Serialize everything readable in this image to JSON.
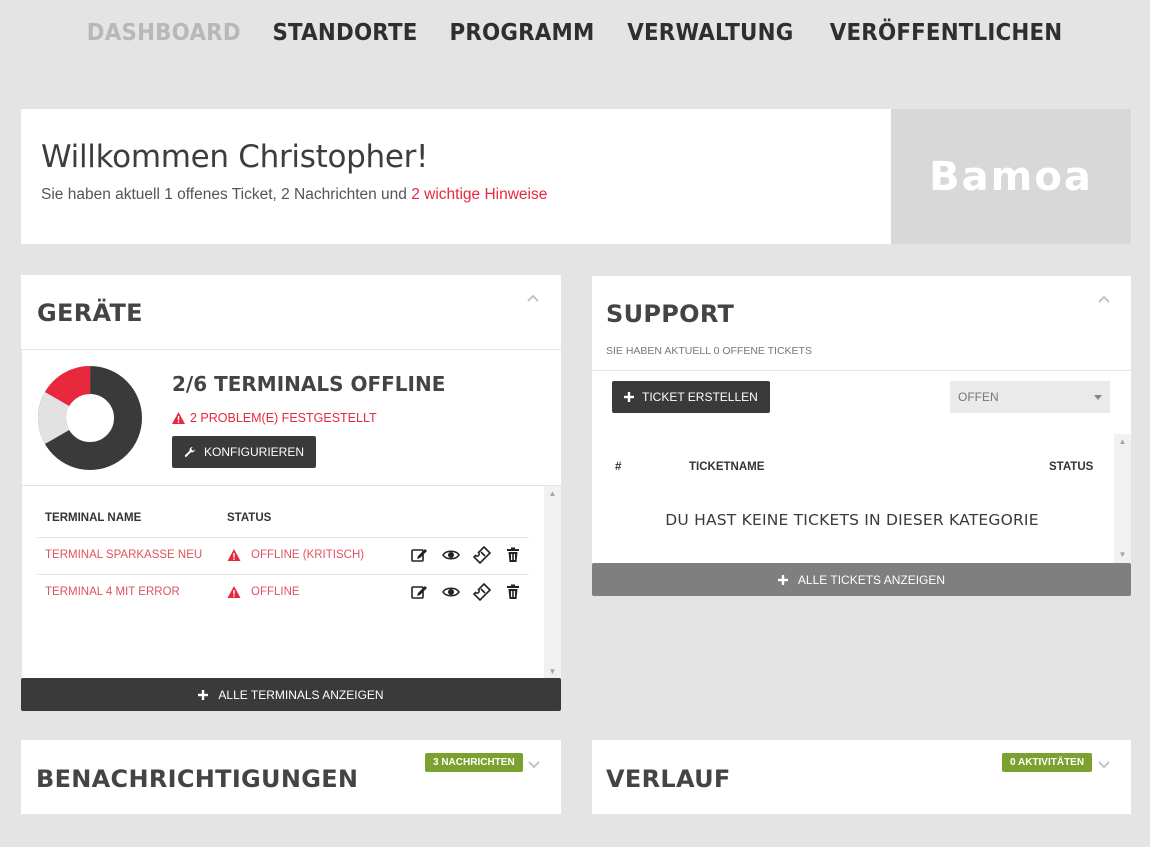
{
  "nav": {
    "items": [
      "DASHBOARD",
      "STANDORTE",
      "PROGRAMM",
      "VERWALTUNG",
      "VERÖFFENTLICHEN"
    ]
  },
  "welcome": {
    "title": "Willkommen Christopher!",
    "text_before": "Sie haben aktuell 1 offenes Ticket, 2 Nachrichten und ",
    "highlight": "2 wichtige Hinweise",
    "logo": "Bamoa"
  },
  "devices": {
    "title": "GERÄTE",
    "headline": "2/6 TERMINALS OFFLINE",
    "problem": "2 PROBLEM(E) FESTGESTELLT",
    "configure_label": "KONFIGURIEREN",
    "donut": {
      "offline_fraction": 0.1667,
      "problem_fraction": 0.1667,
      "online_fraction": 0.6667
    },
    "columns": [
      "TERMINAL NAME",
      "STATUS"
    ],
    "rows": [
      {
        "name": "TERMINAL SPARKASSE NEU",
        "status": "OFFLINE (KRITISCH)"
      },
      {
        "name": "TERMINAL 4 MIT ERROR",
        "status": "OFFLINE"
      }
    ],
    "show_all_label": "ALLE TERMINALS ANZEIGEN"
  },
  "support": {
    "title": "SUPPORT",
    "subtitle": "SIE HABEN AKTUELL 0 OFFENE TICKETS",
    "create_label": "TICKET ERSTELLEN",
    "filter_value": "OFFEN",
    "columns": [
      "#",
      "TICKETNAME",
      "STATUS"
    ],
    "empty_text": "DU HAST KEINE TICKETS IN DIESER KATEGORIE",
    "show_all_label": "ALLE TICKETS ANZEIGEN"
  },
  "notifications": {
    "title": "BENACHRICHTIGUNGEN",
    "badge": "3 NACHRICHTEN"
  },
  "history": {
    "title": "VERLAUF",
    "badge": "0 AKTIVITÄTEN"
  },
  "colors": {
    "accent_red": "#e8283d",
    "dark": "#3a3a3a",
    "badge_green": "#7ba22f",
    "background": "#e4e4e4"
  }
}
